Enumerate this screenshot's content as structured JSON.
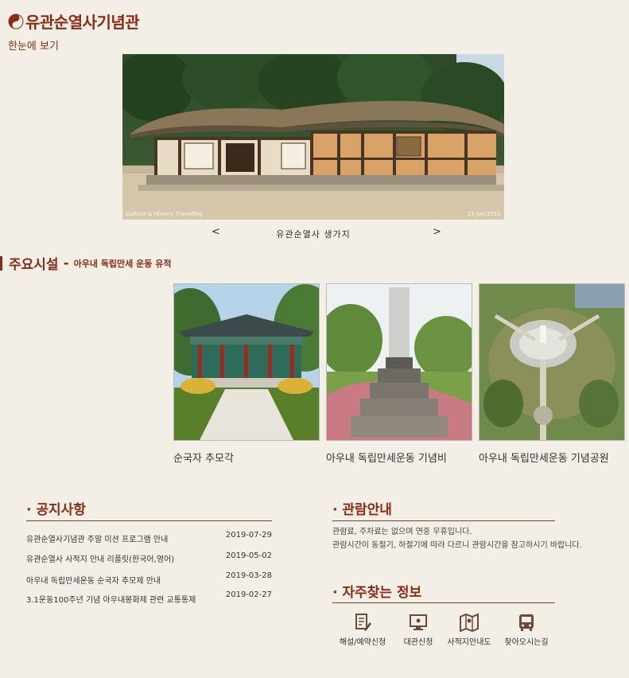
{
  "header": {
    "site_title": "유관순열사기념관",
    "overview_label": "한눈에 보기"
  },
  "hero": {
    "credit_left": "Culture & History Travelling",
    "credit_right": "15 Jun 2011",
    "prev_label": "<",
    "next_label": ">",
    "caption": "유관순열사 생가지"
  },
  "facilities": {
    "title": "주요시설",
    "dash": "-",
    "subtitle": "아우내 독립만세 운동 유적",
    "items": [
      {
        "label": "순국자 추모각"
      },
      {
        "label": "아우내 독립만세운동 기념비"
      },
      {
        "label": "아우내 독립만세운동 기념공원"
      }
    ]
  },
  "notice": {
    "title": "· 공지사항",
    "rows": [
      {
        "text": "유관순열사기념관 주말 미션 프로그램 안내",
        "date": "2019-07-29"
      },
      {
        "text": "유관순열사 사적지 안내 리플릿(한국어,영어)",
        "date": "2019-05-02"
      },
      {
        "text": "아우내 독립만세운동 순국자 추모제 안내",
        "date": "2019-03-28"
      },
      {
        "text": "3.1운동100주년 기념 아우내봉화제 관련 교통통제",
        "date": "2019-02-27"
      }
    ]
  },
  "visit_info": {
    "title": "· 관람안내",
    "line1": "관람료, 주차료는 없으며 연중 무휴입니다.",
    "line2": "관람시간이 동절기, 하절기에 따라 다르니 관람시간을 참고하시기 바랍니다."
  },
  "faq": {
    "title": "· 자주찾는 정보",
    "items": [
      {
        "label": "해설/예약신청",
        "icon": "document-pen-icon"
      },
      {
        "label": "대관신청",
        "icon": "monitor-icon"
      },
      {
        "label": "사적지안내도",
        "icon": "map-icon"
      },
      {
        "label": "찾아오시는길",
        "icon": "bus-icon"
      }
    ]
  },
  "colors": {
    "accent": "#8b2c16",
    "background": "#f3efe6"
  }
}
